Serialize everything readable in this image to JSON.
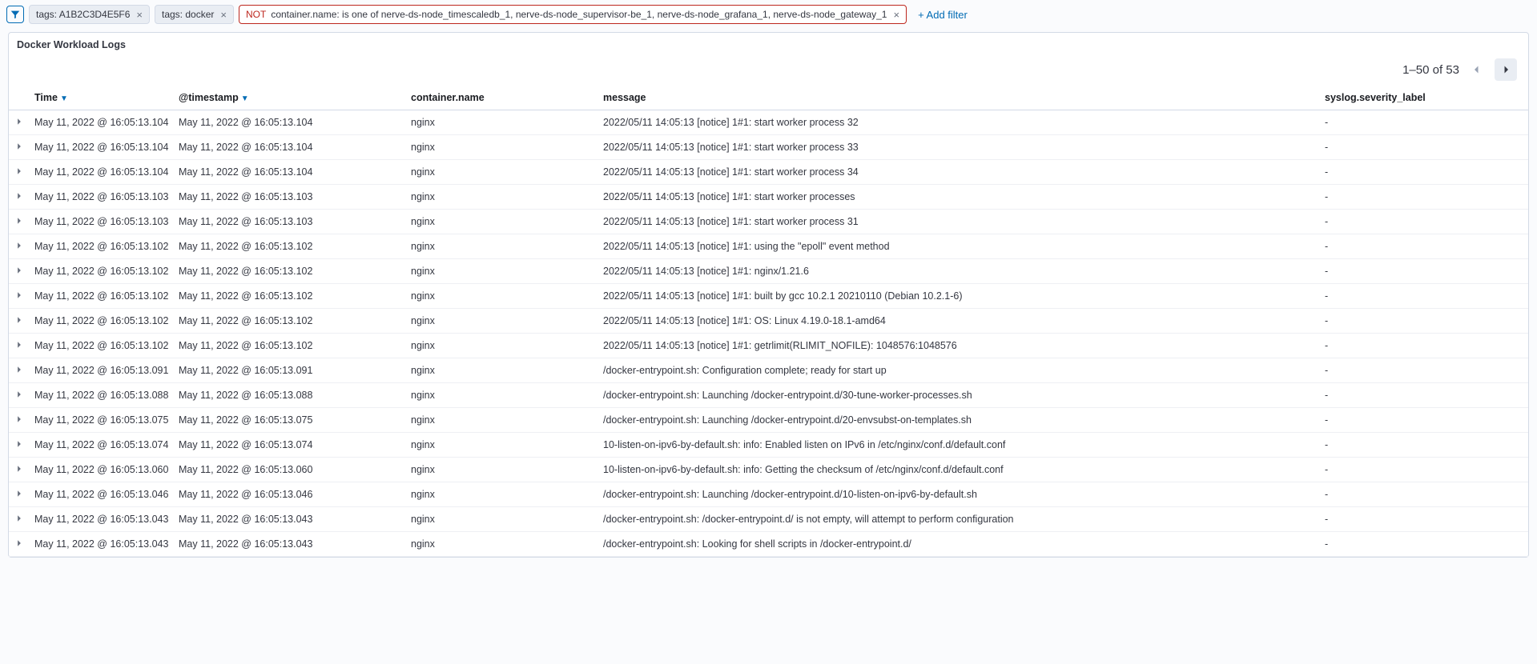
{
  "filter_bar": {
    "pills": [
      {
        "label": "tags: A1B2C3D4E5F6",
        "negated": false
      },
      {
        "label": "tags: docker",
        "negated": false
      },
      {
        "not_word": "NOT",
        "label": "container.name: is one of nerve-ds-node_timescaledb_1, nerve-ds-node_supervisor-be_1, nerve-ds-node_grafana_1, nerve-ds-node_gateway_1",
        "negated": true
      }
    ],
    "add_filter_label": "+ Add filter"
  },
  "panel": {
    "title": "Docker Workload Logs",
    "pager": {
      "range": "1–50 of 53"
    },
    "columns": {
      "time": "Time",
      "timestamp": "@timestamp",
      "container_name": "container.name",
      "message": "message",
      "severity": "syslog.severity_label"
    },
    "rows": [
      {
        "time": "May 11, 2022 @ 16:05:13.104",
        "ts": "May 11, 2022 @ 16:05:13.104",
        "cn": "nginx",
        "msg": "2022/05/11 14:05:13 [notice] 1#1: start worker process 32",
        "sev": "-"
      },
      {
        "time": "May 11, 2022 @ 16:05:13.104",
        "ts": "May 11, 2022 @ 16:05:13.104",
        "cn": "nginx",
        "msg": "2022/05/11 14:05:13 [notice] 1#1: start worker process 33",
        "sev": "-"
      },
      {
        "time": "May 11, 2022 @ 16:05:13.104",
        "ts": "May 11, 2022 @ 16:05:13.104",
        "cn": "nginx",
        "msg": "2022/05/11 14:05:13 [notice] 1#1: start worker process 34",
        "sev": "-"
      },
      {
        "time": "May 11, 2022 @ 16:05:13.103",
        "ts": "May 11, 2022 @ 16:05:13.103",
        "cn": "nginx",
        "msg": "2022/05/11 14:05:13 [notice] 1#1: start worker processes",
        "sev": "-"
      },
      {
        "time": "May 11, 2022 @ 16:05:13.103",
        "ts": "May 11, 2022 @ 16:05:13.103",
        "cn": "nginx",
        "msg": "2022/05/11 14:05:13 [notice] 1#1: start worker process 31",
        "sev": "-"
      },
      {
        "time": "May 11, 2022 @ 16:05:13.102",
        "ts": "May 11, 2022 @ 16:05:13.102",
        "cn": "nginx",
        "msg": "2022/05/11 14:05:13 [notice] 1#1: using the \"epoll\" event method",
        "sev": "-"
      },
      {
        "time": "May 11, 2022 @ 16:05:13.102",
        "ts": "May 11, 2022 @ 16:05:13.102",
        "cn": "nginx",
        "msg": "2022/05/11 14:05:13 [notice] 1#1: nginx/1.21.6",
        "sev": "-"
      },
      {
        "time": "May 11, 2022 @ 16:05:13.102",
        "ts": "May 11, 2022 @ 16:05:13.102",
        "cn": "nginx",
        "msg": "2022/05/11 14:05:13 [notice] 1#1: built by gcc 10.2.1 20210110 (Debian 10.2.1-6)",
        "sev": "-"
      },
      {
        "time": "May 11, 2022 @ 16:05:13.102",
        "ts": "May 11, 2022 @ 16:05:13.102",
        "cn": "nginx",
        "msg": "2022/05/11 14:05:13 [notice] 1#1: OS: Linux 4.19.0-18.1-amd64",
        "sev": "-"
      },
      {
        "time": "May 11, 2022 @ 16:05:13.102",
        "ts": "May 11, 2022 @ 16:05:13.102",
        "cn": "nginx",
        "msg": "2022/05/11 14:05:13 [notice] 1#1: getrlimit(RLIMIT_NOFILE): 1048576:1048576",
        "sev": "-"
      },
      {
        "time": "May 11, 2022 @ 16:05:13.091",
        "ts": "May 11, 2022 @ 16:05:13.091",
        "cn": "nginx",
        "msg": "/docker-entrypoint.sh: Configuration complete; ready for start up",
        "sev": "-"
      },
      {
        "time": "May 11, 2022 @ 16:05:13.088",
        "ts": "May 11, 2022 @ 16:05:13.088",
        "cn": "nginx",
        "msg": "/docker-entrypoint.sh: Launching /docker-entrypoint.d/30-tune-worker-processes.sh",
        "sev": "-"
      },
      {
        "time": "May 11, 2022 @ 16:05:13.075",
        "ts": "May 11, 2022 @ 16:05:13.075",
        "cn": "nginx",
        "msg": "/docker-entrypoint.sh: Launching /docker-entrypoint.d/20-envsubst-on-templates.sh",
        "sev": "-"
      },
      {
        "time": "May 11, 2022 @ 16:05:13.074",
        "ts": "May 11, 2022 @ 16:05:13.074",
        "cn": "nginx",
        "msg": "10-listen-on-ipv6-by-default.sh: info: Enabled listen on IPv6 in /etc/nginx/conf.d/default.conf",
        "sev": "-"
      },
      {
        "time": "May 11, 2022 @ 16:05:13.060",
        "ts": "May 11, 2022 @ 16:05:13.060",
        "cn": "nginx",
        "msg": "10-listen-on-ipv6-by-default.sh: info: Getting the checksum of /etc/nginx/conf.d/default.conf",
        "sev": "-"
      },
      {
        "time": "May 11, 2022 @ 16:05:13.046",
        "ts": "May 11, 2022 @ 16:05:13.046",
        "cn": "nginx",
        "msg": "/docker-entrypoint.sh: Launching /docker-entrypoint.d/10-listen-on-ipv6-by-default.sh",
        "sev": "-"
      },
      {
        "time": "May 11, 2022 @ 16:05:13.043",
        "ts": "May 11, 2022 @ 16:05:13.043",
        "cn": "nginx",
        "msg": "/docker-entrypoint.sh: /docker-entrypoint.d/ is not empty, will attempt to perform configuration",
        "sev": "-"
      },
      {
        "time": "May 11, 2022 @ 16:05:13.043",
        "ts": "May 11, 2022 @ 16:05:13.043",
        "cn": "nginx",
        "msg": "/docker-entrypoint.sh: Looking for shell scripts in /docker-entrypoint.d/",
        "sev": "-"
      }
    ]
  }
}
